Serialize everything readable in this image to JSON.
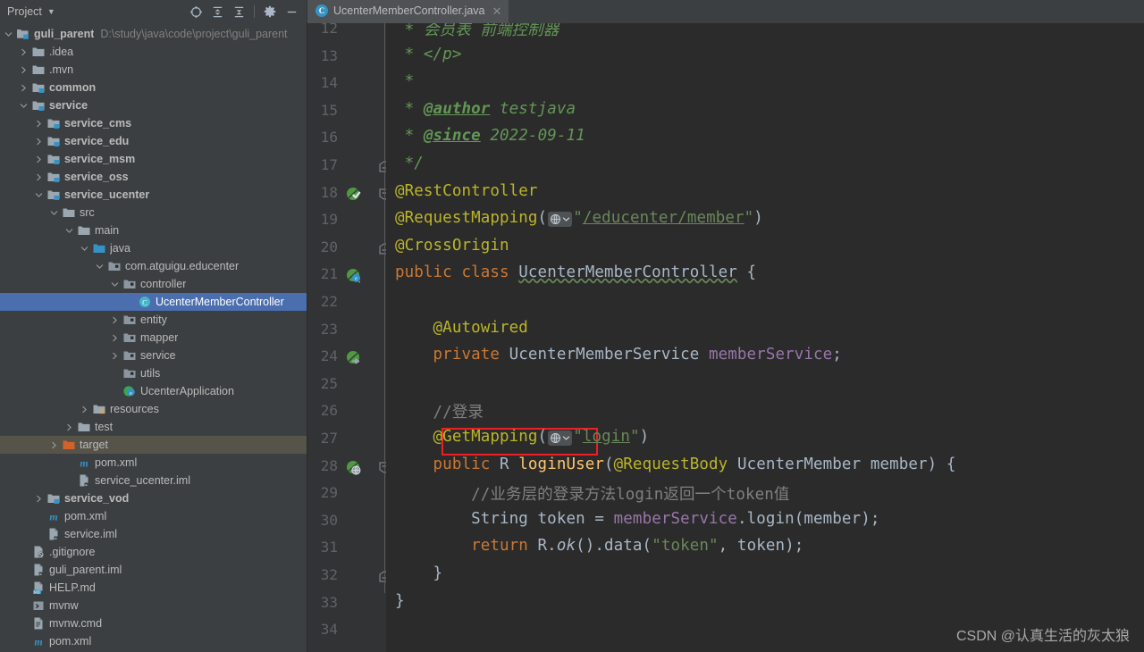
{
  "tool_window": {
    "title": "Project",
    "caret_icon": "chevron-down-icon",
    "actions": [
      {
        "name": "locate-icon",
        "label": "Select Opened File"
      },
      {
        "name": "expand-all-icon",
        "label": "Expand All"
      },
      {
        "name": "collapse-all-icon",
        "label": "Collapse All"
      },
      {
        "name": "gear-icon",
        "label": "Settings"
      },
      {
        "name": "minimize-icon",
        "label": "Hide"
      }
    ]
  },
  "tabs": [
    {
      "label": "UcenterMemberController.java",
      "icon": "java-class-icon",
      "badge": "C",
      "active": true,
      "close_icon": "close-icon"
    }
  ],
  "tree": [
    {
      "indent": 0,
      "arrow": "down",
      "icon": "module-root",
      "label": "guli_parent",
      "bold": true,
      "path": "D:\\study\\java\\code\\project\\guli_parent"
    },
    {
      "indent": 1,
      "arrow": "right",
      "icon": "folder",
      "label": ".idea"
    },
    {
      "indent": 1,
      "arrow": "right",
      "icon": "folder",
      "label": ".mvn"
    },
    {
      "indent": 1,
      "arrow": "right",
      "icon": "module",
      "label": "common",
      "bold": true
    },
    {
      "indent": 1,
      "arrow": "down",
      "icon": "module",
      "label": "service",
      "bold": true
    },
    {
      "indent": 2,
      "arrow": "right",
      "icon": "module",
      "label": "service_cms",
      "bold": true
    },
    {
      "indent": 2,
      "arrow": "right",
      "icon": "module",
      "label": "service_edu",
      "bold": true
    },
    {
      "indent": 2,
      "arrow": "right",
      "icon": "module",
      "label": "service_msm",
      "bold": true
    },
    {
      "indent": 2,
      "arrow": "right",
      "icon": "module",
      "label": "service_oss",
      "bold": true
    },
    {
      "indent": 2,
      "arrow": "down",
      "icon": "module",
      "label": "service_ucenter",
      "bold": true
    },
    {
      "indent": 3,
      "arrow": "down",
      "icon": "folder",
      "label": "src"
    },
    {
      "indent": 4,
      "arrow": "down",
      "icon": "folder",
      "label": "main"
    },
    {
      "indent": 5,
      "arrow": "down",
      "icon": "source-folder",
      "label": "java"
    },
    {
      "indent": 6,
      "arrow": "down",
      "icon": "package",
      "label": "com.atguigu.educenter"
    },
    {
      "indent": 7,
      "arrow": "down",
      "icon": "package",
      "label": "controller"
    },
    {
      "indent": 8,
      "arrow": "none",
      "icon": "java-class",
      "label": "UcenterMemberController",
      "selected": true
    },
    {
      "indent": 7,
      "arrow": "right",
      "icon": "package",
      "label": "entity"
    },
    {
      "indent": 7,
      "arrow": "right",
      "icon": "package",
      "label": "mapper"
    },
    {
      "indent": 7,
      "arrow": "right",
      "icon": "package",
      "label": "service"
    },
    {
      "indent": 7,
      "arrow": "none",
      "icon": "package",
      "label": "utils"
    },
    {
      "indent": 7,
      "arrow": "none",
      "icon": "spring-class",
      "label": "UcenterApplication"
    },
    {
      "indent": 5,
      "arrow": "right",
      "icon": "resource-folder",
      "label": "resources"
    },
    {
      "indent": 4,
      "arrow": "right",
      "icon": "folder",
      "label": "test"
    },
    {
      "indent": 3,
      "arrow": "right",
      "icon": "target-folder",
      "label": "target",
      "highlighted": true
    },
    {
      "indent": 4,
      "arrow": "none",
      "icon": "maven",
      "label": "pom.xml"
    },
    {
      "indent": 4,
      "arrow": "none",
      "icon": "iml",
      "label": "service_ucenter.iml"
    },
    {
      "indent": 2,
      "arrow": "right",
      "icon": "module",
      "label": "service_vod",
      "bold": true
    },
    {
      "indent": 2,
      "arrow": "none",
      "icon": "maven",
      "label": "pom.xml"
    },
    {
      "indent": 2,
      "arrow": "none",
      "icon": "iml",
      "label": "service.iml"
    },
    {
      "indent": 1,
      "arrow": "none",
      "icon": "gitignore",
      "label": ".gitignore"
    },
    {
      "indent": 1,
      "arrow": "none",
      "icon": "iml",
      "label": "guli_parent.iml"
    },
    {
      "indent": 1,
      "arrow": "none",
      "icon": "markdown",
      "label": "HELP.md"
    },
    {
      "indent": 1,
      "arrow": "none",
      "icon": "shell",
      "label": "mvnw"
    },
    {
      "indent": 1,
      "arrow": "none",
      "icon": "cmd",
      "label": "mvnw.cmd"
    },
    {
      "indent": 1,
      "arrow": "none",
      "icon": "maven",
      "label": "pom.xml"
    }
  ],
  "editor": {
    "first_line": 12,
    "lines": [
      {
        "n": 12,
        "gutter": null,
        "fold": null,
        "html": "<span class='c-doc'> * 会员表 前端控制器</span>"
      },
      {
        "n": 13,
        "gutter": null,
        "fold": null,
        "html": "<span class='c-doc'> * &lt;/p&gt;</span>"
      },
      {
        "n": 14,
        "gutter": null,
        "fold": null,
        "html": "<span class='c-doc'> *</span>"
      },
      {
        "n": 15,
        "gutter": null,
        "fold": null,
        "html": "<span class='c-doc'> * </span><span class='c-tag'>@author</span><span class='c-doc'> testjava</span>"
      },
      {
        "n": 16,
        "gutter": null,
        "fold": null,
        "html": "<span class='c-doc'> * </span><span class='c-tag'>@since</span><span class='c-doc'> 2022-09-11</span>"
      },
      {
        "n": 17,
        "gutter": null,
        "fold": "end",
        "html": "<span class='c-doc'> */</span>"
      },
      {
        "n": 18,
        "gutter": "spring-bean-check",
        "fold": "start",
        "html": "<span class='c-ann'>@RestController</span>"
      },
      {
        "n": 19,
        "gutter": null,
        "fold": null,
        "html": "<span class='c-ann'>@RequestMapping</span><span class='c-plain'>(</span>@@INLAY@@<span class='c-str'>\"</span><span class='c-str wavy-u'>/educenter/member</span><span class='c-str'>\"</span><span class='c-plain'>)</span>"
      },
      {
        "n": 20,
        "gutter": null,
        "fold": "end",
        "html": "<span class='c-ann'>@CrossOrigin</span>"
      },
      {
        "n": 21,
        "gutter": "spring-bean-e",
        "fold": null,
        "html": "<span class='c-kw'>public class </span><span class='c-cls'>UcenterMemberController</span><span class='c-plain'> {</span>"
      },
      {
        "n": 22,
        "gutter": null,
        "fold": null,
        "html": ""
      },
      {
        "n": 23,
        "gutter": null,
        "fold": null,
        "html": "    <span class='c-ann'>@Autowired</span>"
      },
      {
        "n": 24,
        "gutter": "spring-bean-arrow",
        "fold": null,
        "html": "    <span class='c-kw'>private </span><span class='c-type'>UcenterMemberService </span><span class='c-fld'>memberService</span><span class='c-plain'>;</span>"
      },
      {
        "n": 25,
        "gutter": null,
        "fold": null,
        "html": ""
      },
      {
        "n": 26,
        "gutter": null,
        "fold": null,
        "html": "    <span class='c-cmt'>//登录</span>"
      },
      {
        "n": 27,
        "gutter": null,
        "fold": null,
        "html": "    <span class='c-ann'>@GetMapping</span><span class='c-plain'>(</span>@@INLAY@@<span class='c-str'>\"</span><span class='c-str wavy-u'>login</span><span class='c-str'>\"</span><span class='c-plain'>)</span>"
      },
      {
        "n": 28,
        "gutter": "spring-bean-globe",
        "fold": "start",
        "html": "    <span class='c-kw'>public </span><span class='c-type'>R </span><span class='c-mth'>loginUser</span><span class='c-plain'>(</span><span class='c-ann'>@RequestBody </span><span class='c-type'>UcenterMember member</span><span class='c-plain'>) {</span>"
      },
      {
        "n": 29,
        "gutter": null,
        "fold": null,
        "html": "        <span class='c-cmt'>//业务层的登录方法login返回一个token值</span>"
      },
      {
        "n": 30,
        "gutter": null,
        "fold": null,
        "html": "        <span class='c-type'>String token </span><span class='c-plain'>= </span><span class='c-fld'>memberService</span><span class='c-plain'>.login(member);</span>"
      },
      {
        "n": 31,
        "gutter": null,
        "fold": null,
        "html": "        <span class='c-kw'>return </span><span class='c-plain'>R.</span><span class='c-itl c-plain'>ok</span><span class='c-plain'>().data(</span><span class='c-str'>\"token\"</span><span class='c-plain'>, token);</span>"
      },
      {
        "n": 32,
        "gutter": null,
        "fold": "end",
        "html": "    <span class='c-plain'>}</span>"
      },
      {
        "n": 33,
        "gutter": null,
        "fold": null,
        "html": "<span class='c-plain'>}</span>"
      },
      {
        "n": 34,
        "gutter": null,
        "fold": null,
        "html": ""
      }
    ],
    "highlight_box": {
      "line": 27,
      "label": "@GetMapping",
      "color": "#ec2024"
    }
  },
  "watermark": "CSDN @认真生活的灰太狼",
  "colors": {
    "editor_bg": "#2b2b2b",
    "panel_bg": "#3c3f41",
    "gutter_bg": "#313335",
    "selection": "#4b6eaf",
    "highlight_row": "#565449",
    "accent_red": "#ec2024"
  }
}
